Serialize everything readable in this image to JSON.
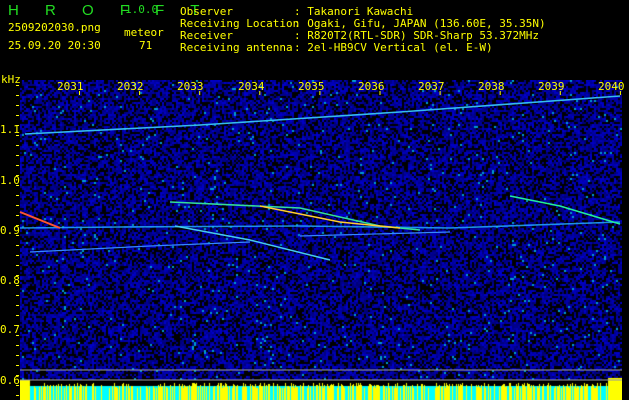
{
  "header": {
    "app_name": "H R O F F T",
    "version": "1.0.0",
    "filename": "2509202030.png",
    "datetime": "25.09.20 20:30",
    "meteor_label": "meteor",
    "meteor_count": "71",
    "info": [
      {
        "label": "Observer",
        "value": ": Takanori Kawachi"
      },
      {
        "label": "Receiving Location",
        "value": ": Ogaki, Gifu, JAPAN (136.60E, 35.35N)"
      },
      {
        "label": "Receiver",
        "value": ": R820T2(RTL-SDR) SDR-Sharp 53.372MHz"
      },
      {
        "label": "Receiving antenna",
        "value": ": 2el-HB9CV Vertical (el. E-W)"
      }
    ]
  },
  "axes": {
    "y_unit": "kHz",
    "y_ticks": [
      "1.1",
      "1.0",
      "0.9",
      "0.8",
      "0.7",
      "0.6"
    ],
    "x_ticks": [
      "2031",
      "2032",
      "2033",
      "2034",
      "2035",
      "2036",
      "2037",
      "2038",
      "2039",
      "2040"
    ]
  },
  "colors": {
    "text": "#ffff00",
    "logo": "#22dd22",
    "background_noise": "#0a1a8a",
    "histogram": "#ffff00",
    "histogram_base": "#00ffff"
  }
}
